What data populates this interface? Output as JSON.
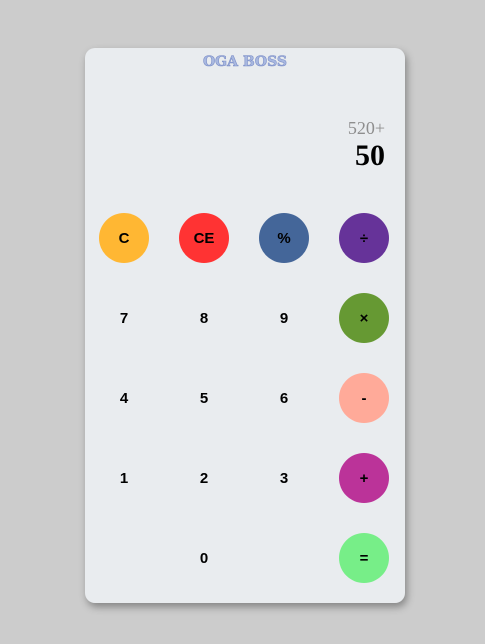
{
  "calculator": {
    "brand": "OGA BOSS",
    "display": {
      "expression": "520+",
      "result": "50"
    },
    "keys": {
      "clear": {
        "label": "C",
        "color": "#ffb733"
      },
      "clear_entry": {
        "label": "CE",
        "color": "#ff3333"
      },
      "percent": {
        "label": "%",
        "color": "#446699"
      },
      "divide": {
        "label": "÷",
        "color": "#663399"
      },
      "seven": {
        "label": "7"
      },
      "eight": {
        "label": "8"
      },
      "nine": {
        "label": "9"
      },
      "multiply": {
        "label": "×",
        "color": "#669933"
      },
      "four": {
        "label": "4"
      },
      "five": {
        "label": "5"
      },
      "six": {
        "label": "6"
      },
      "minus": {
        "label": "-",
        "color": "#ffaa99"
      },
      "one": {
        "label": "1"
      },
      "two": {
        "label": "2"
      },
      "three": {
        "label": "3"
      },
      "plus": {
        "label": "+",
        "color": "#bb3399"
      },
      "zero": {
        "label": "0"
      },
      "equals": {
        "label": "=",
        "color": "#77ee88"
      }
    }
  }
}
